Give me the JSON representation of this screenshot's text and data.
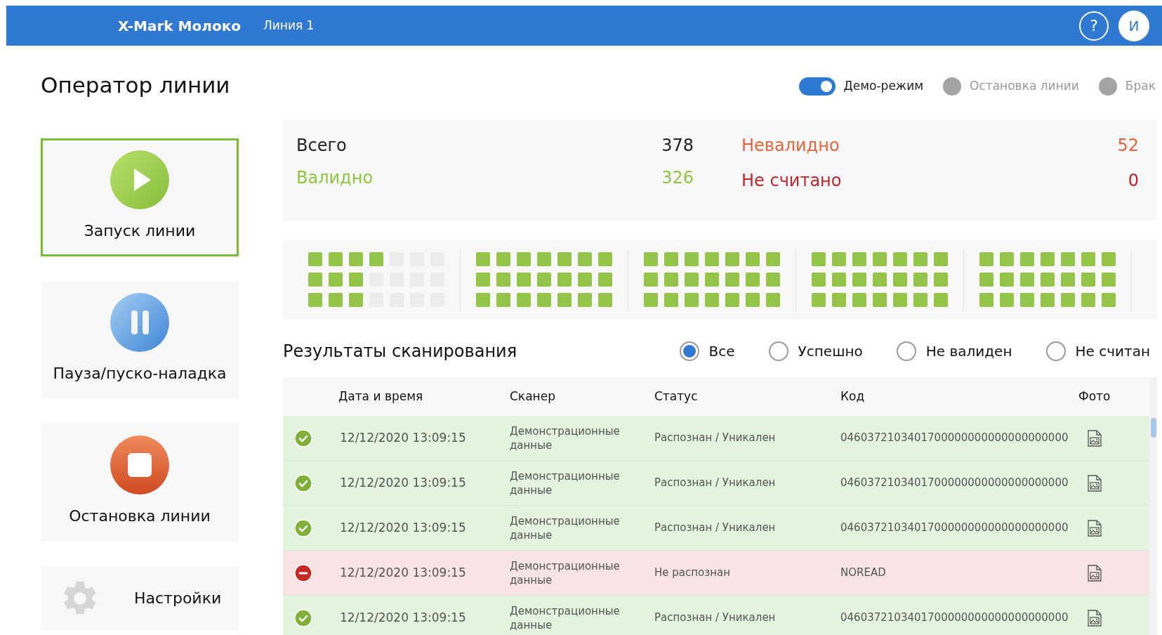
{
  "header": {
    "app_title": "X-Mark Молоко",
    "line": "Линия 1",
    "help": "?",
    "avatar": "И"
  },
  "page_title": "Оператор линии",
  "toggles": [
    {
      "kind": "switch",
      "label": "Демо-режим",
      "on": true
    },
    {
      "kind": "dot",
      "label": "Остановка линии",
      "on": false
    },
    {
      "kind": "dot",
      "label": "Брак",
      "on": false
    }
  ],
  "actions": [
    {
      "kind": "play",
      "label": "Запуск линии",
      "selected": true
    },
    {
      "kind": "pause",
      "label": "Пауза/пуско-наладка",
      "selected": false
    },
    {
      "kind": "stop",
      "label": "Остановка линии",
      "selected": false
    },
    {
      "kind": "settings",
      "label": "Настройки",
      "selected": false
    }
  ],
  "stats": [
    {
      "label": "Всего",
      "value": "378",
      "color": "#222222"
    },
    {
      "label": "Валидно",
      "value": "326",
      "color": "#8cc63f"
    },
    {
      "label": "Невалидно",
      "value": "52",
      "color": "#e8643c"
    },
    {
      "label": "Не считано",
      "value": "0",
      "color": "#c0272d"
    }
  ],
  "groups": [
    {
      "rows": [
        [
          true,
          true,
          true,
          true,
          false,
          false,
          false
        ],
        [
          true,
          true,
          true,
          false,
          false,
          false,
          false
        ],
        [
          true,
          true,
          true,
          false,
          false,
          false,
          false
        ]
      ]
    },
    {
      "rows": [
        [
          true,
          true,
          true,
          true,
          true,
          true,
          true
        ],
        [
          true,
          true,
          true,
          true,
          true,
          true,
          true
        ],
        [
          true,
          true,
          true,
          true,
          true,
          true,
          true
        ]
      ]
    },
    {
      "rows": [
        [
          true,
          true,
          true,
          true,
          true,
          true,
          true
        ],
        [
          true,
          true,
          true,
          true,
          true,
          true,
          true
        ],
        [
          true,
          true,
          true,
          true,
          true,
          true,
          true
        ]
      ]
    },
    {
      "rows": [
        [
          true,
          true,
          true,
          true,
          true,
          true,
          true
        ],
        [
          true,
          true,
          true,
          true,
          true,
          true,
          true
        ],
        [
          true,
          true,
          true,
          true,
          true,
          true,
          true
        ]
      ]
    },
    {
      "rows": [
        [
          true,
          true,
          true,
          true,
          true,
          true,
          true
        ],
        [
          true,
          true,
          true,
          true,
          true,
          true,
          true
        ],
        [
          true,
          true,
          true,
          true,
          true,
          true,
          true
        ]
      ]
    }
  ],
  "results": {
    "title": "Результаты сканирования",
    "filters": [
      {
        "label": "Все",
        "selected": true
      },
      {
        "label": "Успешно",
        "selected": false
      },
      {
        "label": "Не валиден",
        "selected": false
      },
      {
        "label": "Не считан",
        "selected": false
      }
    ],
    "columns": [
      "Дата и время",
      "Сканер",
      "Статус",
      "Код",
      "Фото"
    ],
    "rows": [
      {
        "kind": "valid",
        "datetime": "12/12/2020 13:09:15",
        "scanner": "Демонстрационные данные",
        "status": "Распознан / Уникален",
        "code": "0460372103401700000000000000000000"
      },
      {
        "kind": "valid",
        "datetime": "12/12/2020 13:09:15",
        "scanner": "Демонстрационные данные",
        "status": "Распознан / Уникален",
        "code": "0460372103401700000000000000000000"
      },
      {
        "kind": "valid",
        "datetime": "12/12/2020 13:09:15",
        "scanner": "Демонстрационные данные",
        "status": "Распознан / Уникален",
        "code": "0460372103401700000000000000000000"
      },
      {
        "kind": "invalid",
        "datetime": "12/12/2020 13:09:15",
        "scanner": "Демонстрационные данные",
        "status": "Не распознан",
        "code": "NOREAD"
      },
      {
        "kind": "valid",
        "datetime": "12/12/2020 13:09:15",
        "scanner": "Демонстрационные данные",
        "status": "Распознан / Уникален",
        "code": "0460372103401700000000000000000000"
      }
    ]
  }
}
